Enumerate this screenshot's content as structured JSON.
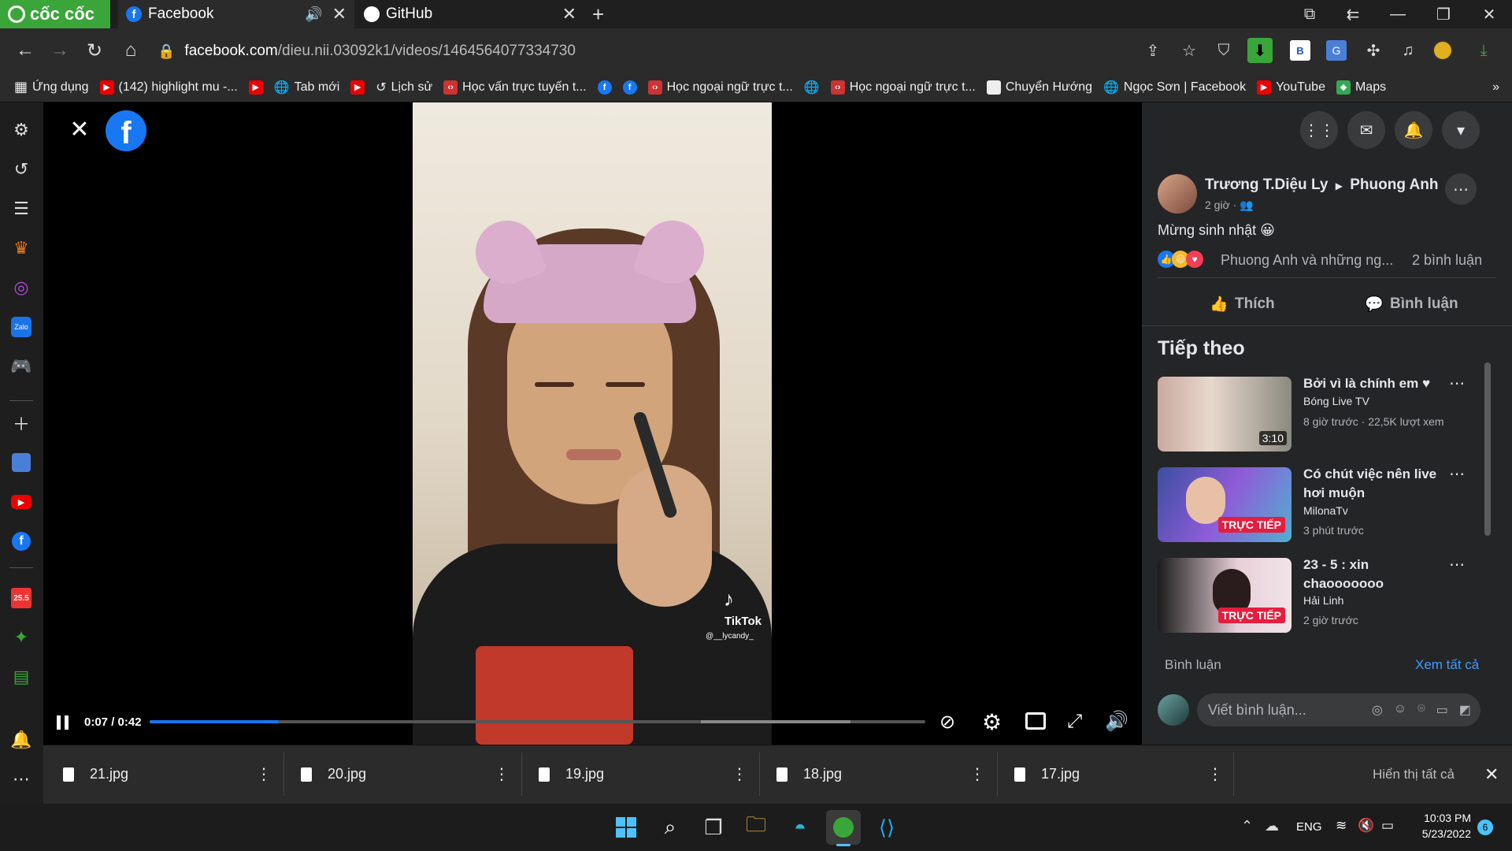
{
  "browser": {
    "brand": "cốc cốc",
    "tabs": [
      {
        "title": "Facebook",
        "active": true
      },
      {
        "title": "GitHub",
        "active": false
      }
    ],
    "url": {
      "domain": "facebook.com",
      "path": "/dieu.nii.03092k1/videos/1464564077334730"
    }
  },
  "bookmarks": [
    "Ứng dụng",
    "(142) highlight mu -...",
    "Tab mới",
    "Lịch sử",
    "Học vấn trực tuyến t...",
    "Học ngoại ngữ trực t...",
    "Học ngoại ngữ trực t...",
    "Chuyển Hướng",
    "Ngọc Sơn | Facebook",
    "YouTube",
    "Maps"
  ],
  "video": {
    "watermark": "TikTok",
    "handle": "@__lycandy_",
    "time_current": "0:07",
    "time_total": "0:42",
    "progress": 0.167
  },
  "post": {
    "author": "Trương T.Diệu Ly",
    "target": "Phuong Anh",
    "time": "2 giờ",
    "text": "Mừng sinh nhật 😀",
    "reactions_text": "Phuong Anh và những ng...",
    "comments_count": "2 bình luận",
    "like_label": "Thích",
    "comment_label": "Bình luận"
  },
  "next_section": {
    "title": "Tiếp theo",
    "items": [
      {
        "title": "Bởi vì là chính em ♥",
        "channel": "Bóng Live TV",
        "meta": "8 giờ trước · 22,5K lượt xem",
        "duration": "3:10",
        "live": ""
      },
      {
        "title": "Có chút việc nên live hơi muộn",
        "channel": "MilonaTv",
        "meta": "3 phút trước",
        "duration": "",
        "live": "TRỰC TIẾP"
      },
      {
        "title": "23 - 5 : xin chaooooooo",
        "channel": "Hải Linh",
        "meta": "2 giờ trước",
        "duration": "",
        "live": "TRỰC TIẾP"
      }
    ]
  },
  "comments": {
    "label": "Bình luận",
    "see_all": "Xem tất cả",
    "placeholder": "Viết bình luận..."
  },
  "downloads": {
    "files": [
      "21.jpg",
      "20.jpg",
      "19.jpg",
      "18.jpg",
      "17.jpg"
    ],
    "show_all": "Hiển thị tất cả"
  },
  "taskbar": {
    "lang": "ENG",
    "time": "10:03 PM",
    "date": "5/23/2022",
    "notif": "6"
  },
  "sidebar_badge": "25.5"
}
